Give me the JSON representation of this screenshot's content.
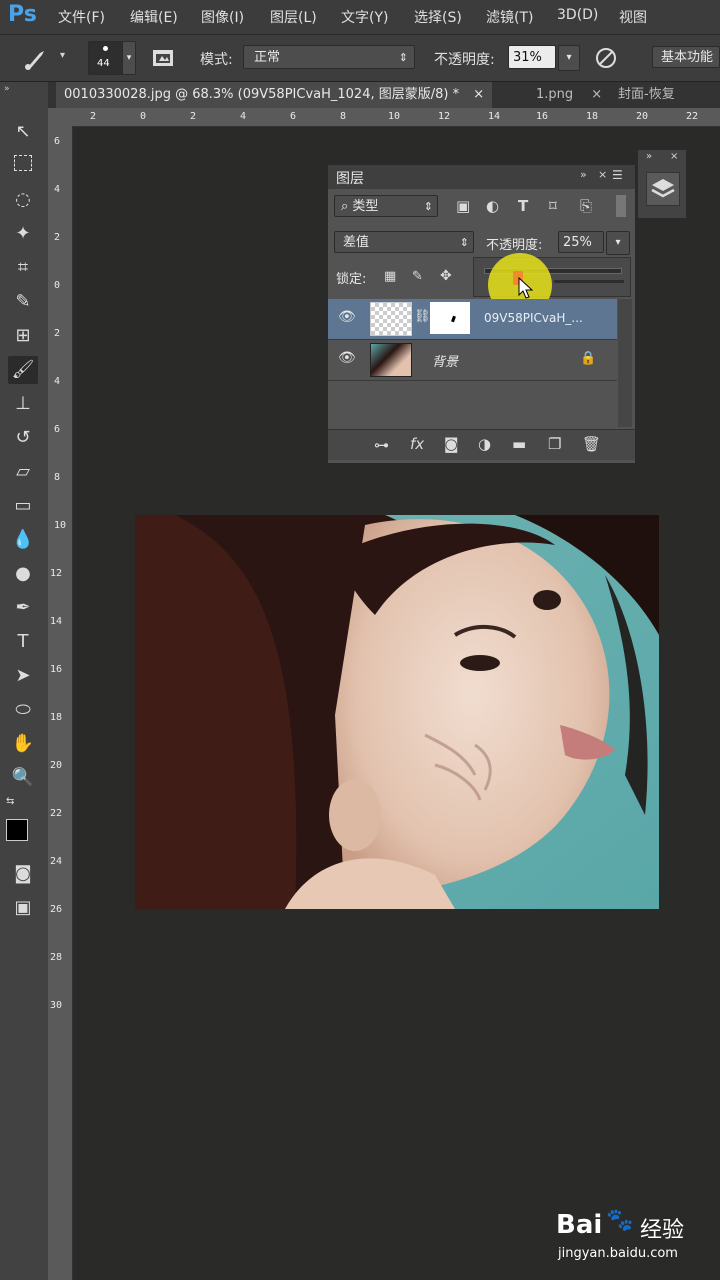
{
  "app": {
    "logo": "Ps"
  },
  "menu": [
    "文件(F)",
    "编辑(E)",
    "图像(I)",
    "图层(L)",
    "文字(Y)",
    "选择(S)",
    "滤镜(T)",
    "3D(D)",
    "视图"
  ],
  "options": {
    "brush_size": "44",
    "mode_label": "模式:",
    "mode_value": "正常",
    "opacity_label": "不透明度:",
    "opacity_value": "31%",
    "workspace": "基本功能"
  },
  "tabs": [
    {
      "label": "0010330028.jpg @ 68.3% (09V58PICvaH_1024, 图层蒙版/8) *",
      "close": "×"
    },
    {
      "label": "1.png",
      "close": "×"
    },
    {
      "label": "封面-恢复",
      "close": ""
    }
  ],
  "ruler": {
    "h": [
      "2",
      "0",
      "2",
      "4",
      "6",
      "8",
      "10",
      "12",
      "14",
      "16",
      "18",
      "20",
      "22"
    ],
    "v": [
      "6",
      "4",
      "2",
      "0",
      "2",
      "4",
      "6",
      "8",
      "10",
      "12",
      "14",
      "16",
      "18",
      "20",
      "22",
      "24",
      "26",
      "28",
      "30"
    ]
  },
  "layers_panel": {
    "title": "图层",
    "filter_value": "类型",
    "blend_value": "差值",
    "opacity_label": "不透明度:",
    "opacity_value": "25%",
    "lock_label": "锁定:",
    "layers": [
      {
        "name": "09V58PICvaH_...",
        "selected": true
      },
      {
        "name": "背景",
        "locked": true
      }
    ]
  },
  "watermark": {
    "brand": "Bai",
    "brand2": "经验",
    "url": "jingyan.baidu.com"
  },
  "colors": {
    "accent": "#4aa3e8",
    "selected_layer": "#5e7691",
    "highlight": "#e8e21a"
  }
}
